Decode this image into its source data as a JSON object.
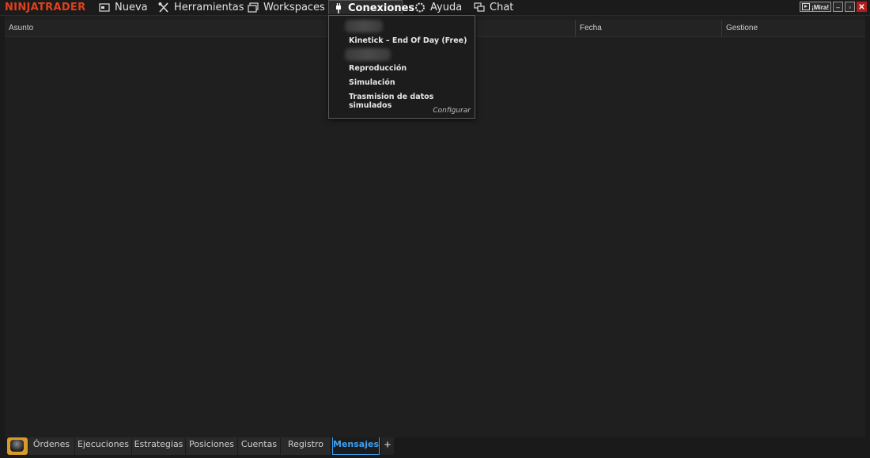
{
  "app": {
    "logo": "NINJATRADER"
  },
  "menu": {
    "items": [
      {
        "label": "Nueva",
        "icon": "new-window-icon"
      },
      {
        "label": "Herramientas",
        "icon": "tools-icon"
      },
      {
        "label": "Workspaces",
        "icon": "workspaces-icon"
      },
      {
        "label": "Conexiones",
        "icon": "plug-icon",
        "active": true
      },
      {
        "label": "Ayuda",
        "icon": "help-ring-icon"
      },
      {
        "label": "Chat",
        "icon": "chat-icon"
      }
    ]
  },
  "window_controls": {
    "mira_label": "¡Mira!",
    "minimize": "–",
    "restore": "▫",
    "close": "✕"
  },
  "grid": {
    "columns": [
      "Asunto",
      "Fecha",
      "Gestione"
    ]
  },
  "connections_menu": {
    "items": [
      "Kinetick – End Of Day (Free)",
      "Reproducción",
      "Simulación",
      "Trasmision de datos simulados"
    ],
    "configure": "Configurar"
  },
  "tabs": {
    "items": [
      "Órdenes",
      "Ejecuciones",
      "Estrategias",
      "Posiciones",
      "Cuentas",
      "Registro",
      "Mensajes"
    ],
    "active": "Mensajes",
    "add_label": "+"
  },
  "colors": {
    "brand": "#e0401c",
    "accent": "#3ea0f0",
    "tab_icon": "#d89b2b",
    "close": "#b21d1d"
  }
}
